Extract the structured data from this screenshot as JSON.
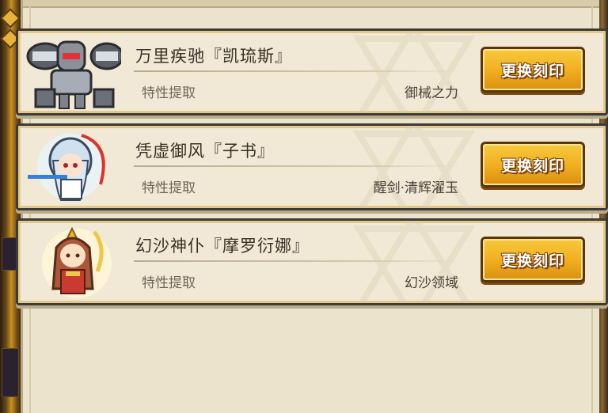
{
  "cards": [
    {
      "name": "万里疾驰『凯琉斯』",
      "trait_label": "特性提取",
      "trait_value": "御械之力",
      "button_label": "更换刻印",
      "portrait_icon": "mech-knight-icon"
    },
    {
      "name": "凭虚御风『子书』",
      "trait_label": "特性提取",
      "trait_value": "醒剑·清辉濯玉",
      "button_label": "更换刻印",
      "portrait_icon": "swordswoman-icon"
    },
    {
      "name": "幻沙神仆『摩罗衍娜』",
      "trait_label": "特性提取",
      "trait_value": "幻沙领域",
      "button_label": "更换刻印",
      "portrait_icon": "sand-priestess-icon"
    }
  ],
  "colors": {
    "panel_bg": "#ece3cd",
    "card_bg": "#f1e9d6",
    "button_gold": "#f0ad1e",
    "card_border": "#3d3a38"
  }
}
